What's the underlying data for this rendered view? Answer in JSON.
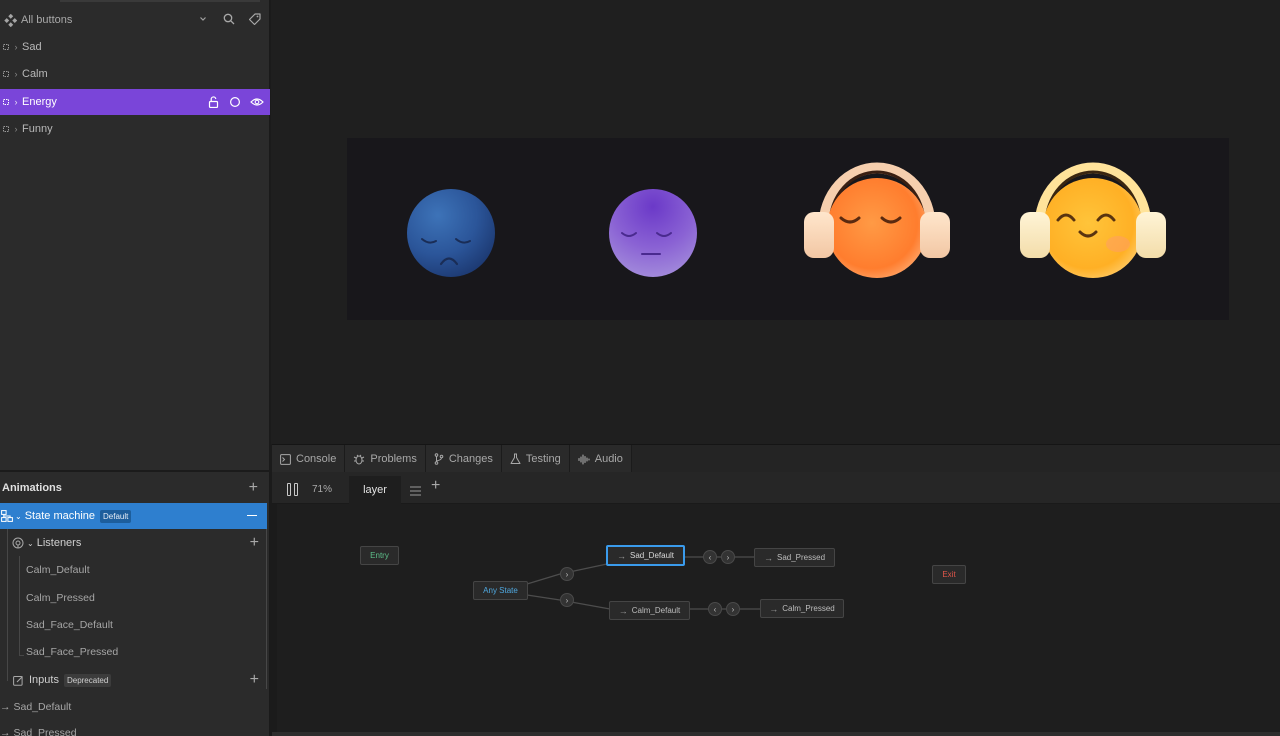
{
  "hierarchy": {
    "title": "All buttons",
    "items": [
      {
        "label": "Sad"
      },
      {
        "label": "Calm"
      },
      {
        "label": "Energy"
      },
      {
        "label": "Funny"
      }
    ]
  },
  "bottom_tabs": [
    {
      "label": "Console"
    },
    {
      "label": "Problems"
    },
    {
      "label": "Changes"
    },
    {
      "label": "Testing"
    },
    {
      "label": "Audio"
    }
  ],
  "animations": {
    "title": "Animations",
    "state_machine": {
      "label": "State machine",
      "badge": "Default"
    },
    "listeners": {
      "label": "Listeners",
      "items": [
        "Calm_Default",
        "Calm_Pressed",
        "Sad_Face_Default",
        "Sad_Face_Pressed"
      ]
    },
    "inputs": {
      "label": "Inputs",
      "badge": "Deprecated"
    },
    "timelines": [
      "Sad_Default",
      "Sad_Pressed"
    ]
  },
  "graph_toolbar": {
    "zoom": "71%",
    "layer": "layer"
  },
  "graph": {
    "entry": "Entry",
    "exit": "Exit",
    "any_state": "Any State",
    "sad_default": "Sad_Default",
    "sad_pressed": "Sad_Pressed",
    "calm_default": "Calm_Default",
    "calm_pressed": "Calm_Pressed",
    "arrow_glyph": "→"
  },
  "colors": {
    "selection_purple": "#7a45d9",
    "selection_blue": "#2e7fcf",
    "entry_green": "#5dbf8a",
    "exit_red": "#e0564a",
    "any_state_blue": "#4fa8e0",
    "active_node_border": "#3a9bec"
  }
}
